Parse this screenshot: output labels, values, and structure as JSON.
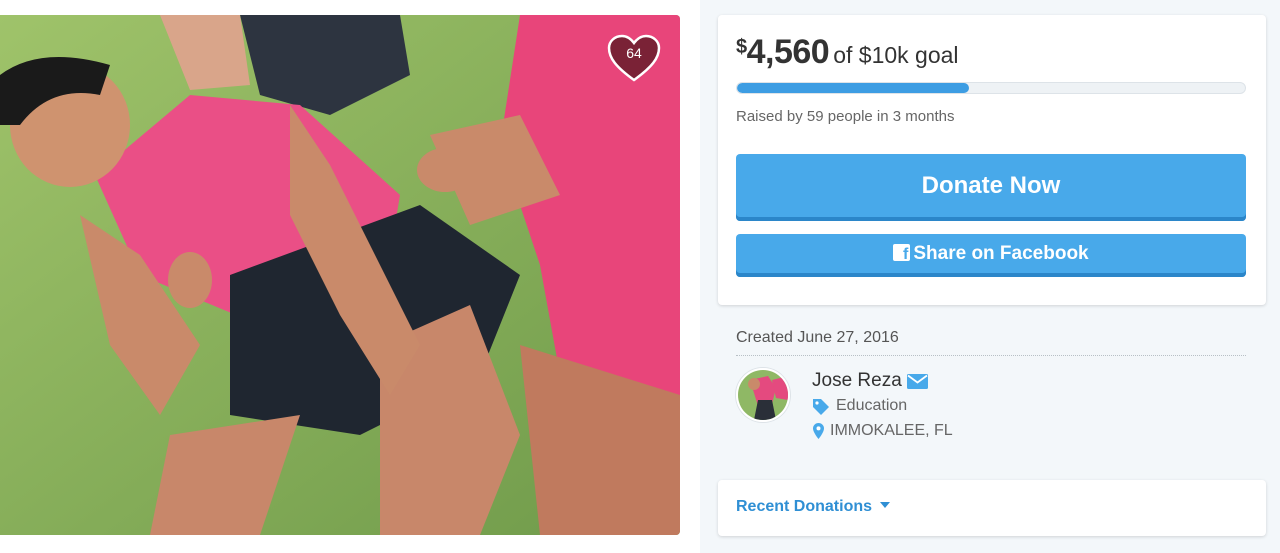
{
  "campaign": {
    "heart_count": "64",
    "photo_alt": "Campaign photo"
  },
  "funding": {
    "currency_symbol": "$",
    "raised_amount": "4,560",
    "goal_text": "of $10k goal",
    "progress_fraction": 0.456,
    "raised_by_text": "Raised by 59 people in 3 months"
  },
  "actions": {
    "donate_label": "Donate Now",
    "share_label": "Share on Facebook",
    "facebook_glyph": "f"
  },
  "organizer": {
    "created_text": "Created June 27, 2016",
    "name": "Jose Reza",
    "category": "Education",
    "location": "IMMOKALEE, FL"
  },
  "donations": {
    "recent_label": "Recent Donations"
  },
  "colors": {
    "accent_blue": "#48a9ea",
    "progress_blue": "#3d9de3",
    "heart_fill": "#7a2236",
    "link_blue": "#2f8fd4"
  },
  "icons": {
    "heart": "heart-icon",
    "facebook": "facebook-icon",
    "mail": "mail-icon",
    "tag": "tag-icon",
    "pin": "map-pin-icon",
    "caret": "caret-down-icon"
  }
}
